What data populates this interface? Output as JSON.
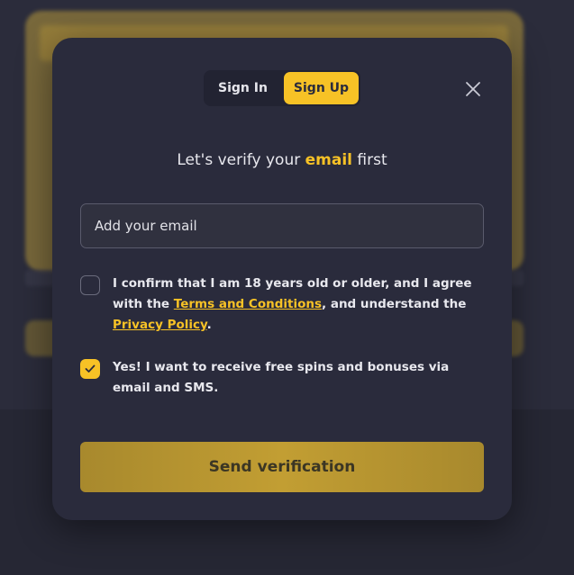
{
  "tabs": [
    {
      "label": "Sign In",
      "active": false
    },
    {
      "label": "Sign Up",
      "active": true
    }
  ],
  "heading": {
    "prefix": "Let's verify your ",
    "highlight": "email",
    "suffix": " first"
  },
  "email_input": {
    "placeholder": "Add your email",
    "value": ""
  },
  "age_confirm": {
    "checked": false,
    "text_1": "I confirm that I am 18 years old or older, and I agree with the ",
    "terms_link": "Terms and Conditions",
    "text_2": ", and understand the ",
    "privacy_link": "Privacy Policy",
    "text_3": "."
  },
  "marketing_opt_in": {
    "checked": true,
    "text": "Yes! I want to receive free spins and bonuses via email and SMS."
  },
  "send_button": {
    "label": "Send verification"
  },
  "colors": {
    "accent": "#f7c226",
    "modal_bg": "#2a2b3c",
    "page_bg": "#2b2c3b"
  },
  "icons": {
    "close": "close-icon",
    "check": "check-icon"
  }
}
